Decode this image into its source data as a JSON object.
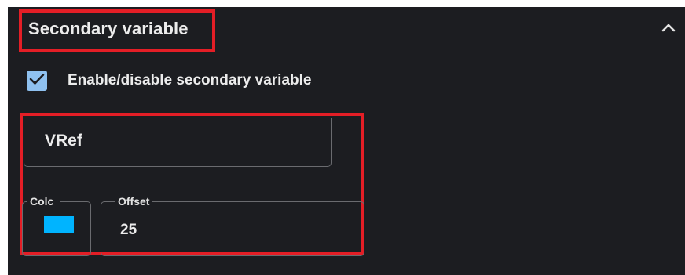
{
  "section": {
    "title": "Secondary variable",
    "collapse_icon": "chevron-up-icon"
  },
  "checkbox": {
    "label": "Enable/disable secondary variable",
    "checked": true,
    "icon": "checkmark-icon"
  },
  "name_field": {
    "value": "VRef"
  },
  "color_field": {
    "label": "Colc",
    "swatch_color": "#00b4ff"
  },
  "offset_field": {
    "label": "Offset",
    "value": "25"
  },
  "colors": {
    "panel_bg": "#1c1d21",
    "checkbox_fill": "#8fc1f0",
    "highlight_border": "#e41e26"
  }
}
